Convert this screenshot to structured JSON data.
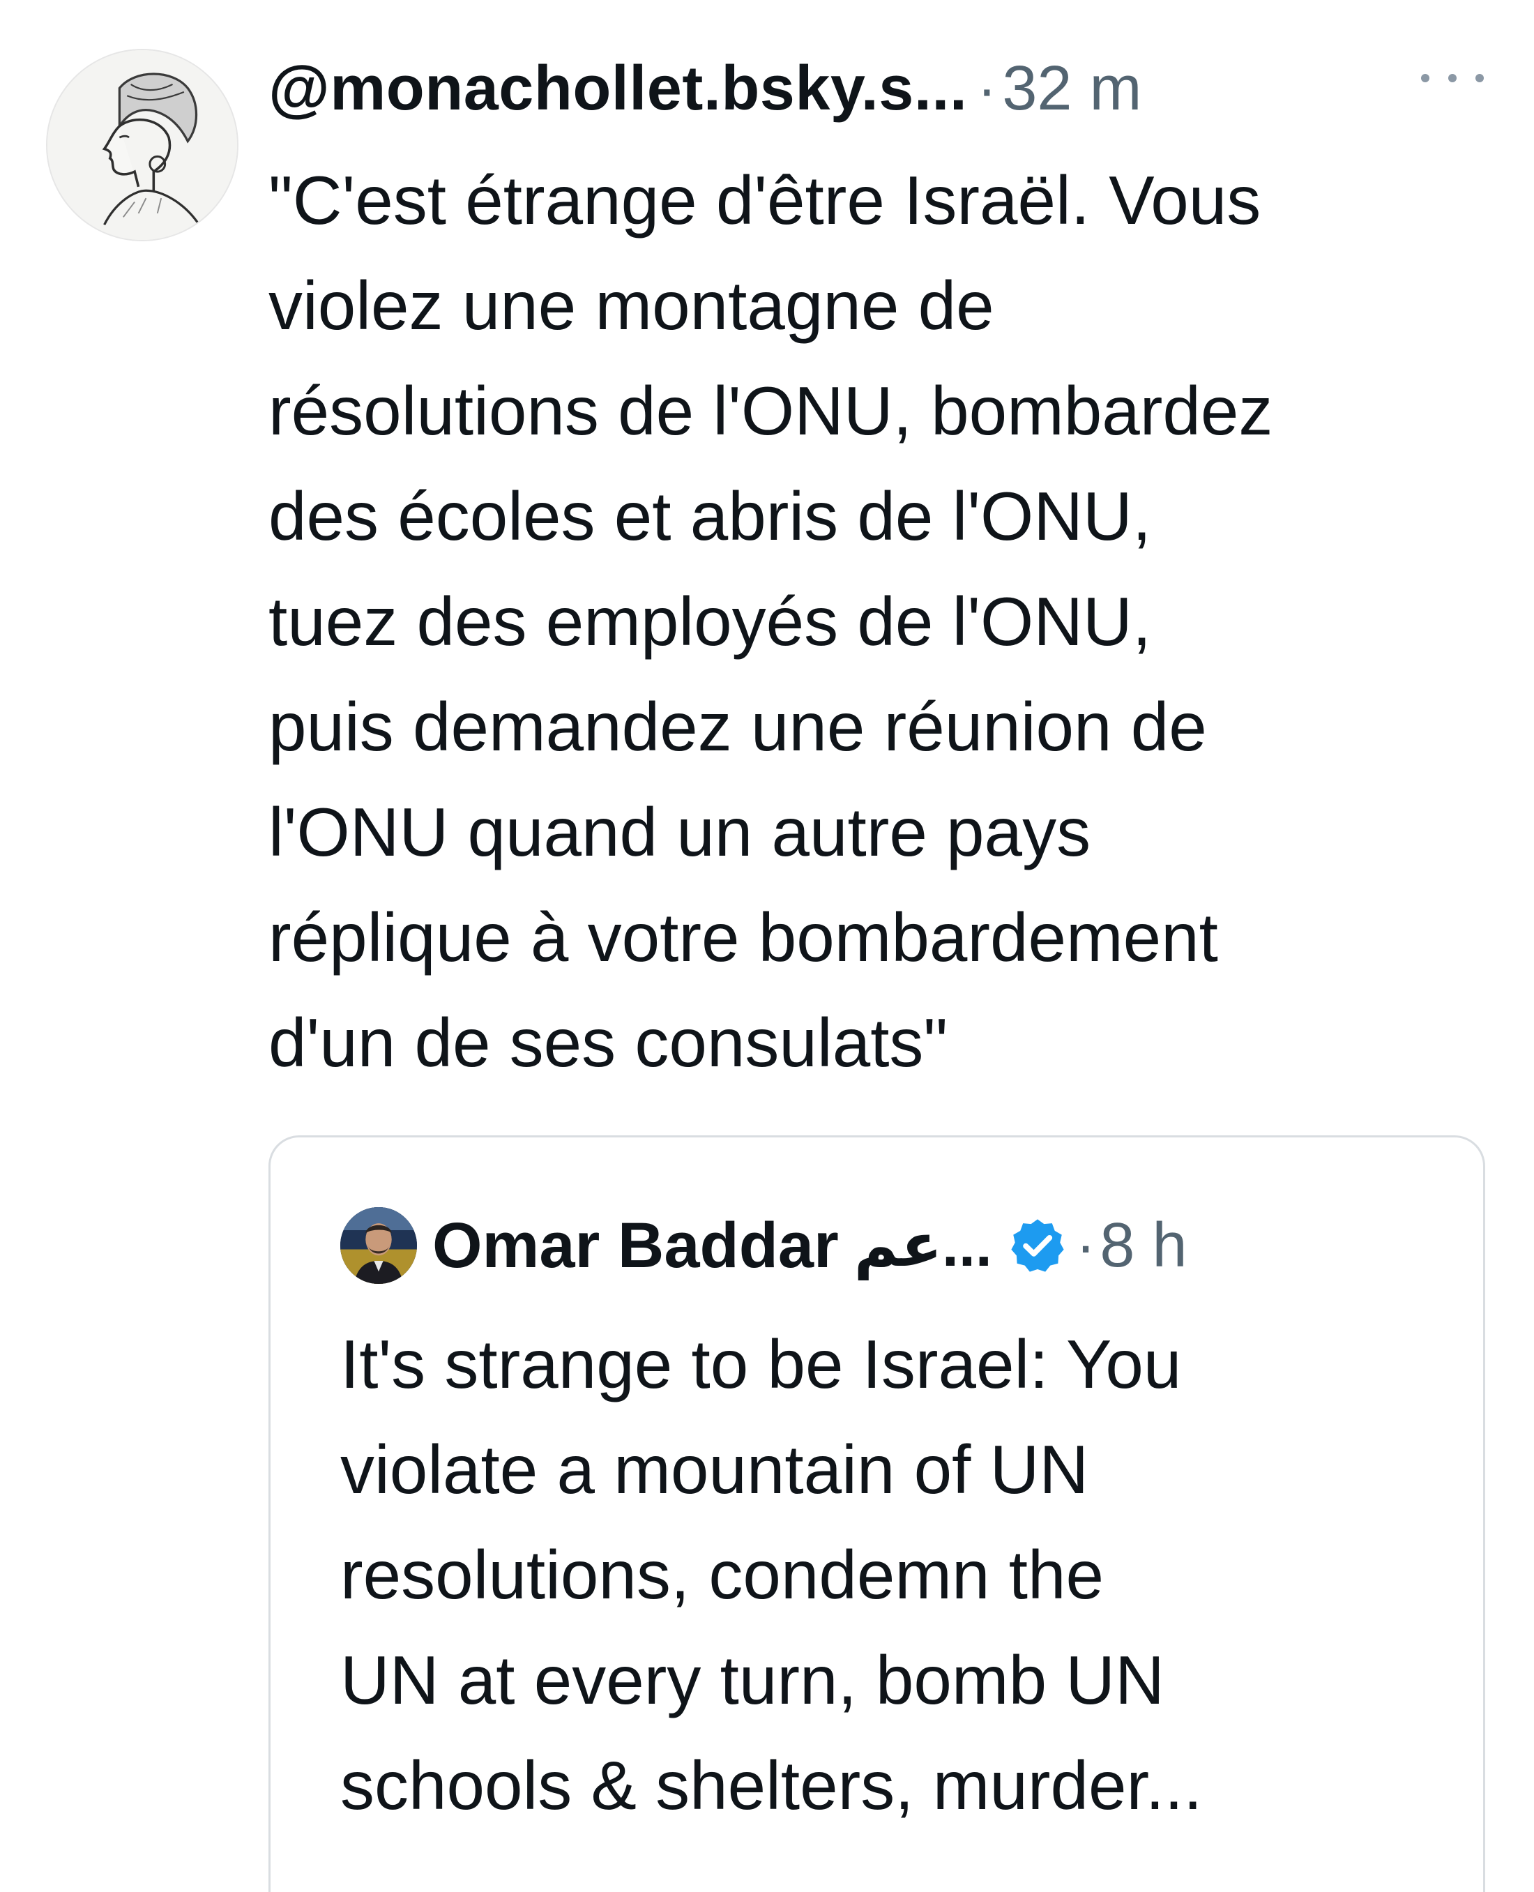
{
  "post": {
    "handle": "@monachollet.bsky.s...",
    "separator": "·",
    "time": "32 m",
    "more_icon": "more-horizontal-icon",
    "text_lines": [
      "\"C'est étrange d'être Israël. Vous",
      "violez une montagne de",
      "résolutions de l'ONU, bombardez",
      "des écoles et abris de l'ONU,",
      "tuez des employés de l'ONU,",
      "puis demandez une réunion de",
      "l'ONU quand un autre pays",
      "réplique à votre bombardement",
      "d'un de ses consulats\""
    ]
  },
  "quoted": {
    "name": "Omar Baddar",
    "arabic_name": "...عم",
    "verified_icon": "verified-badge-icon",
    "separator": "·",
    "time": "8 h",
    "text_lines": [
      "It's strange to be Israel: You",
      "violate a mountain of UN",
      "resolutions, condemn the",
      "UN at every turn, bomb UN",
      "schools & shelters, murder..."
    ]
  },
  "colors": {
    "text": "#0f1419",
    "muted": "#536471",
    "verified": "#1d9bf0",
    "border": "#d9dde1"
  }
}
